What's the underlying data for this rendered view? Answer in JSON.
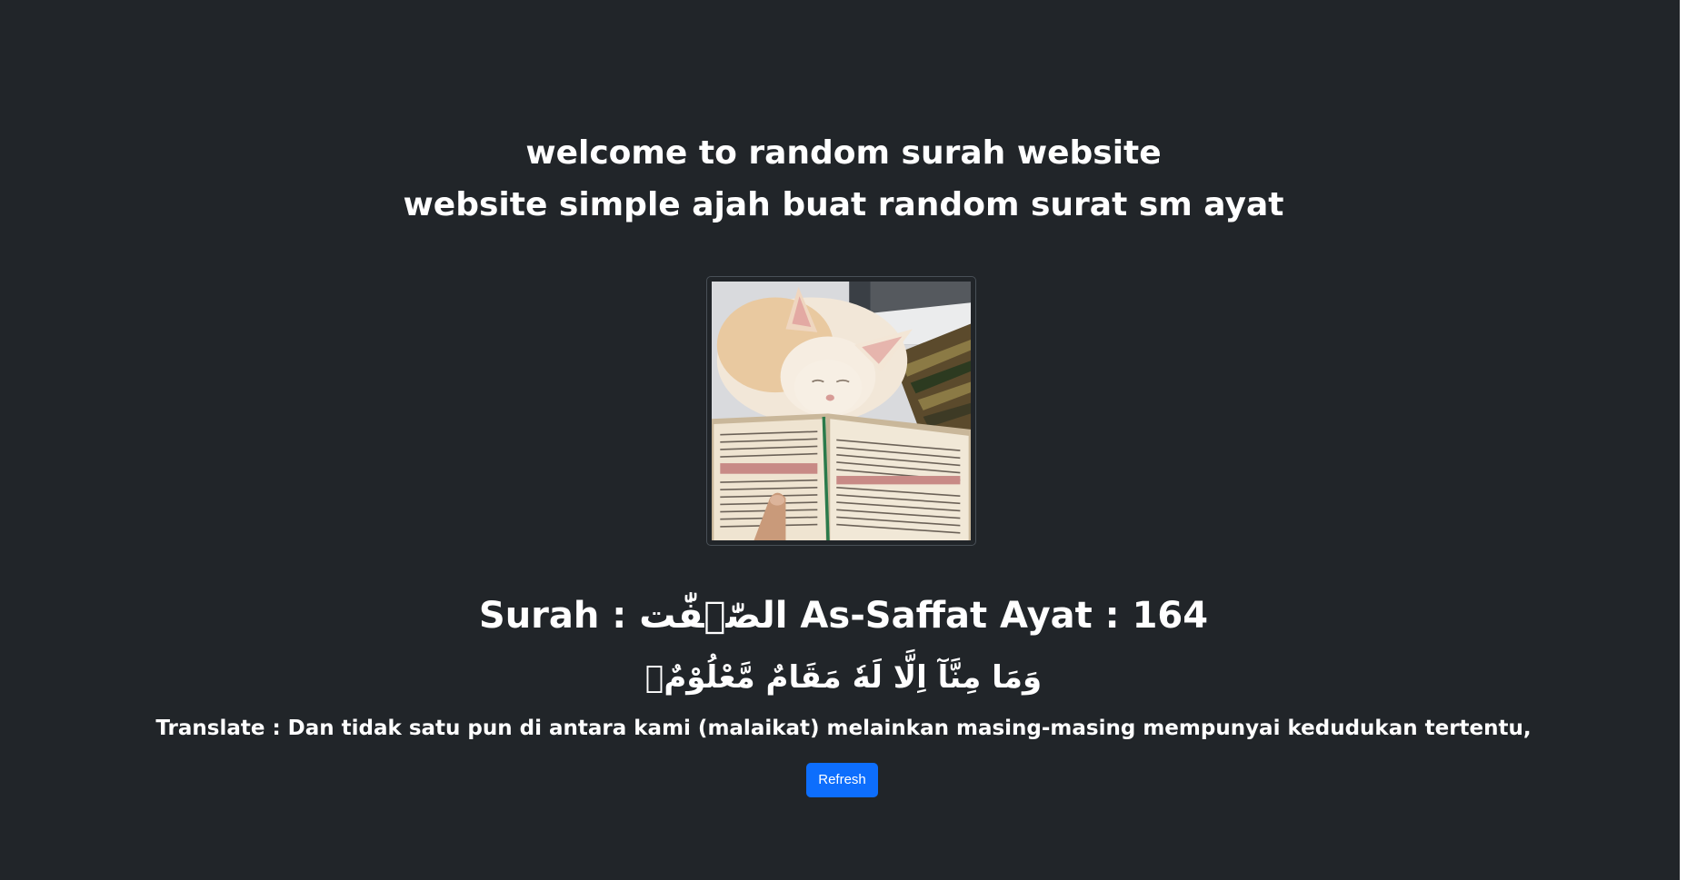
{
  "header": {
    "line1": "welcome to random surah website",
    "line2": "website simple ajah buat random surat sm ayat"
  },
  "image": {
    "alt": "cat reading quran"
  },
  "surah": {
    "line": "Surah : الصّٰۤفّٰت As-Saffat Ayat : 164",
    "arabic": "وَمَا مِنَّآ اِلَّا لَهٗ مَقَامٌ مَّعْلُوْمٌۙ",
    "translate": "Translate : Dan tidak satu pun di antara kami (malaikat) melainkan masing-masing mempunyai kedudukan tertentu,"
  },
  "actions": {
    "refresh_label": "Refresh"
  },
  "colors": {
    "background": "#212529",
    "button": "#0d6efd",
    "text": "#ffffff"
  }
}
